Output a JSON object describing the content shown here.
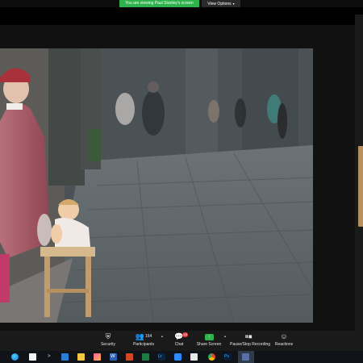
{
  "banner": {
    "viewing_text": "You are viewing Paul Stanley's screen",
    "view_options_label": "View Options",
    "view_options_caret": "▾",
    "accent_color": "#2fb24c"
  },
  "toolbar": {
    "items": [
      {
        "label": "Security",
        "icon": "shield-icon"
      },
      {
        "label": "Participants",
        "icon": "participants-icon",
        "count": "164"
      },
      {
        "label": "Chat",
        "icon": "chat-icon",
        "badge": "10"
      },
      {
        "label": "Share Screen",
        "icon": "share-screen-icon"
      },
      {
        "label": "Pause/Stop Recording",
        "icon": "pause-recording-icon"
      },
      {
        "label": "Reactions",
        "icon": "reactions-icon"
      }
    ]
  },
  "taskbar": {
    "apps": [
      "edge-icon",
      "store-icon",
      "terminal-icon",
      "mail-icon",
      "file-explorer-icon",
      "photos-icon",
      "word-icon",
      "powerpoint-icon",
      "excel-icon",
      "lightroom-icon",
      "zoom-icon",
      "capture-icon",
      "chrome-icon",
      "photoshop-icon",
      "active-app-icon"
    ],
    "text_glyphs": {
      "terminal": ">",
      "word": "W",
      "lightroom": "Lr",
      "photoshop": "Ps"
    }
  }
}
